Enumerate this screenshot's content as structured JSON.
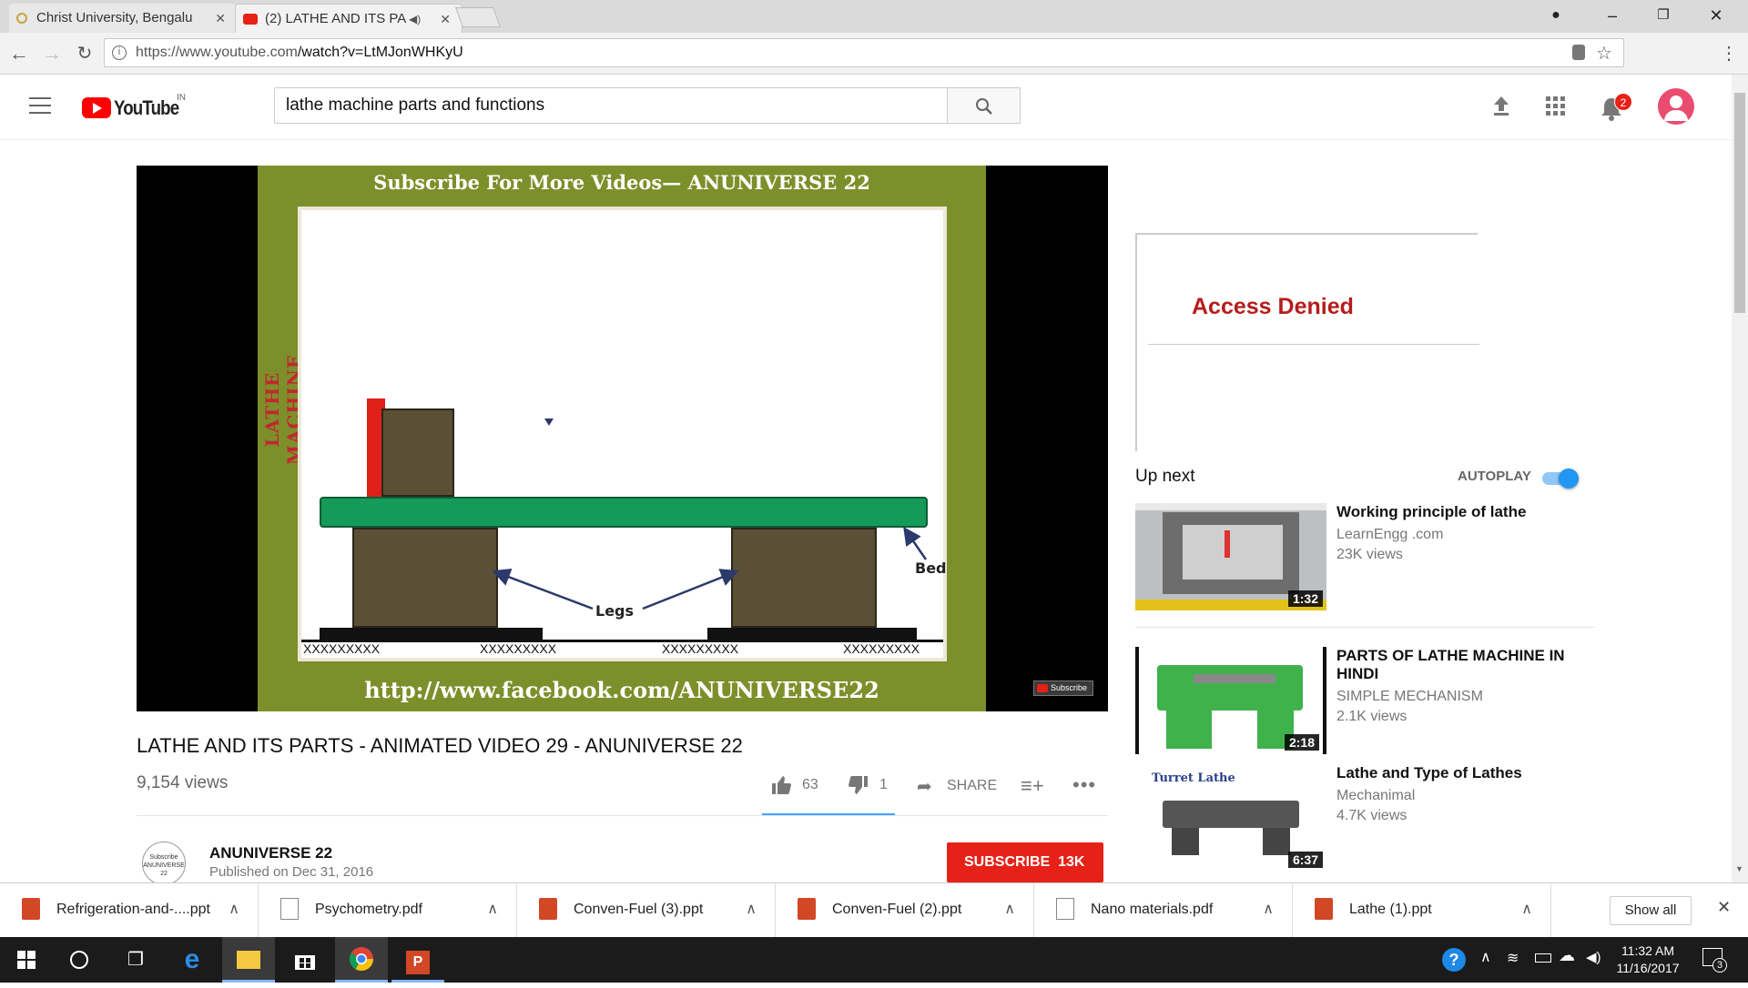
{
  "browser": {
    "tabs": [
      {
        "title": "Christ University, Bengalu",
        "active": false
      },
      {
        "title": "(2) LATHE AND ITS PA",
        "active": true
      }
    ],
    "url_host": "https://www.youtube.com",
    "url_path": "/watch?v=LtMJonWHKyU"
  },
  "youtube": {
    "logo_text": "YouTube",
    "region": "IN",
    "search_value": "lathe machine parts and functions",
    "notification_count": "2"
  },
  "video": {
    "frame": {
      "banner_top": "Subscribe For  More Videos— ANUNIVERSE 22",
      "side_label": "LATHE  MACHINE",
      "label_bed": "Bed",
      "label_legs": "Legs",
      "ground_marks": "XXXXXXXXX",
      "banner_bottom": "http://www.facebook.com/ANUNIVERSE22",
      "subscribe_badge": "Subscribe"
    },
    "title": "LATHE AND ITS PARTS - ANIMATED VIDEO 29 - ANUNIVERSE 22",
    "views": "9,154 views",
    "likes": "63",
    "dislikes": "1",
    "share_label": "SHARE",
    "channel_name": "ANUNIVERSE 22",
    "published": "Published on Dec 31, 2016",
    "avatar_text": "Subscribe ANUNIVERSE 22",
    "subscribe_label": "SUBSCRIBE",
    "subscriber_count": "13K"
  },
  "ad": {
    "text": "Access Denied"
  },
  "upnext": {
    "label": "Up next",
    "autoplay_label": "AUTOPLAY",
    "autoplay_on": true,
    "items": [
      {
        "title": "Working principle of lathe",
        "channel": "LearnEngg .com",
        "views": "23K views",
        "duration": "1:32"
      },
      {
        "title": "PARTS OF LATHE MACHINE IN HINDI",
        "channel": "SIMPLE MECHANISM",
        "views": "2.1K views",
        "duration": "2:18"
      },
      {
        "title": "Lathe and Type of Lathes",
        "channel": "Mechanimal",
        "views": "4.7K views",
        "duration": "6:37",
        "thumb_caption": "Turret Lathe"
      }
    ]
  },
  "downloads": {
    "items": [
      {
        "name": "Refrigeration-and-....ppt",
        "type": "ppt"
      },
      {
        "name": "Psychometry.pdf",
        "type": "pdf"
      },
      {
        "name": "Conven-Fuel (3).ppt",
        "type": "ppt"
      },
      {
        "name": "Conven-Fuel (2).ppt",
        "type": "ppt"
      },
      {
        "name": "Nano materials.pdf",
        "type": "pdf"
      },
      {
        "name": "Lathe (1).ppt",
        "type": "ppt"
      }
    ],
    "show_all": "Show all"
  },
  "taskbar": {
    "time": "11:32 AM",
    "date": "11/16/2017",
    "notif_count": "3"
  },
  "colors": {
    "yt_red": "#ff0000",
    "subscribe_red": "#e62117",
    "autoplay_blue": "#2196f3",
    "frame_green": "#7d8f2b",
    "bed_green": "#159a5a",
    "access_denied": "#b71c1c"
  }
}
